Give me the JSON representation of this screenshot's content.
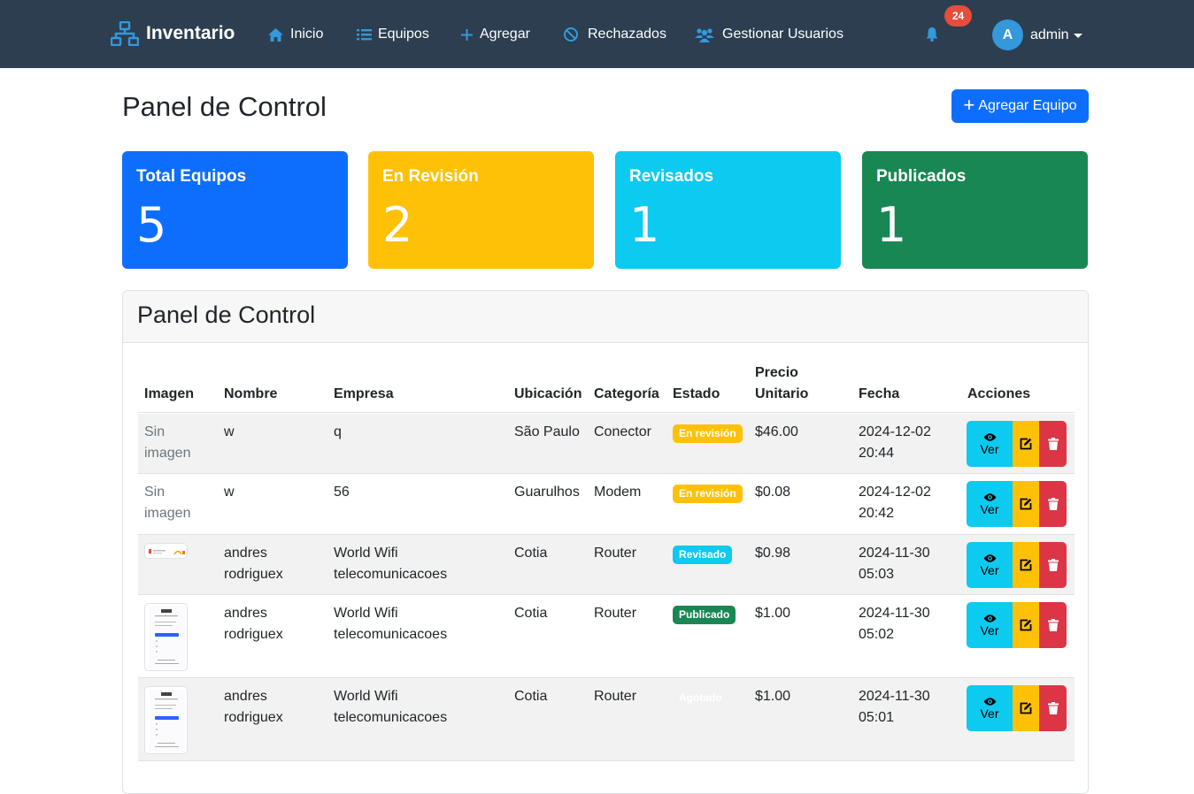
{
  "nav": {
    "brand": "Inventario",
    "items": [
      {
        "label": "Inicio",
        "icon": "home-icon"
      },
      {
        "label": "Equipos",
        "icon": "list-icon"
      },
      {
        "label": "Agregar",
        "icon": "plus-icon"
      },
      {
        "label": "Rechazados",
        "icon": "ban-icon"
      },
      {
        "label": "Gestionar Usuarios",
        "icon": "users-icon"
      }
    ],
    "notifications": "24",
    "user_initial": "A",
    "username": "admin"
  },
  "page": {
    "title": "Panel de Control",
    "add_button": "Agregar Equipo"
  },
  "stats": [
    {
      "label": "Total Equipos",
      "value": "5",
      "color": "#0d6efd"
    },
    {
      "label": "En Revisión",
      "value": "2",
      "color": "#ffc107"
    },
    {
      "label": "Revisados",
      "value": "1",
      "color": "#0dcaf0"
    },
    {
      "label": "Publicados",
      "value": "1",
      "color": "#198754"
    }
  ],
  "table": {
    "title": "Panel de Control",
    "headers": {
      "imagen": "Imagen",
      "nombre": "Nombre",
      "empresa": "Empresa",
      "ubicacion": "Ubicación",
      "categoria": "Categoría",
      "estado": "Estado",
      "precio_1": "Precio",
      "precio_2": "Unitario",
      "fecha": "Fecha",
      "acciones": "Acciones"
    },
    "view_label": "Ver",
    "rows": [
      {
        "imagen_1": "Sin",
        "imagen_2": "imagen",
        "nombre_1": "w",
        "nombre_2": "",
        "empresa_1": "q",
        "empresa_2": "",
        "ubicacion": "São Paulo",
        "categoria": "Conector",
        "estado": "En revisión",
        "precio": "$46.00",
        "fecha_1": "2024-12-02",
        "fecha_2": "20:44"
      },
      {
        "imagen_1": "Sin",
        "imagen_2": "imagen",
        "nombre_1": "w",
        "nombre_2": "",
        "empresa_1": "56",
        "empresa_2": "",
        "ubicacion": "Guarulhos",
        "categoria": "Modem",
        "estado": "En revisión",
        "precio": "$0.08",
        "fecha_1": "2024-12-02",
        "fecha_2": "20:42"
      },
      {
        "nombre_1": "andres",
        "nombre_2": "rodriguex",
        "empresa_1": "World Wifi",
        "empresa_2": "telecomunicacoes",
        "ubicacion": "Cotia",
        "categoria": "Router",
        "estado": "Revisado",
        "precio": "$0.98",
        "fecha_1": "2024-11-30",
        "fecha_2": "05:03"
      },
      {
        "nombre_1": "andres",
        "nombre_2": "rodriguex",
        "empresa_1": "World Wifi",
        "empresa_2": "telecomunicacoes",
        "ubicacion": "Cotia",
        "categoria": "Router",
        "estado": "Publicado",
        "precio": "$1.00",
        "fecha_1": "2024-11-30",
        "fecha_2": "05:02"
      },
      {
        "nombre_1": "andres",
        "nombre_2": "rodriguex",
        "empresa_1": "World Wifi",
        "empresa_2": "telecomunicacoes",
        "ubicacion": "Cotia",
        "categoria": "Router",
        "estado": "Agotado",
        "precio": "$1.00",
        "fecha_1": "2024-11-30",
        "fecha_2": "05:01"
      }
    ]
  }
}
